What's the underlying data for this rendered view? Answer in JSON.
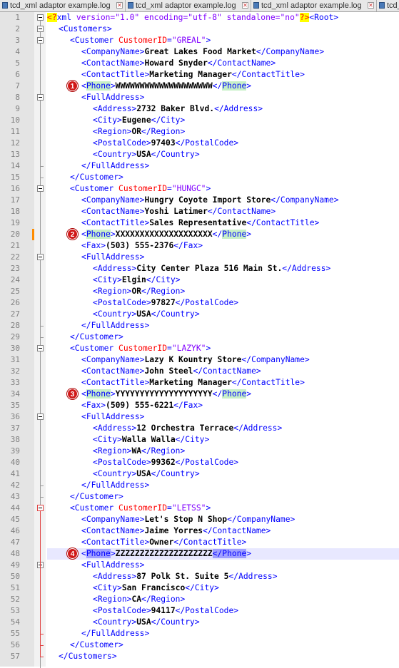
{
  "tabs": [
    {
      "label": "tcd_xml adaptor example.log"
    },
    {
      "label": "tcd_xml adaptor example.log"
    },
    {
      "label": "tcd_xml adaptor example.log"
    },
    {
      "label": "tcd_"
    }
  ],
  "tab_close_glyph": "✕",
  "badges": [
    "1",
    "2",
    "3",
    "4"
  ],
  "lines": [
    {
      "n": "1",
      "k": "decl"
    },
    {
      "n": "2",
      "k": "open",
      "indent": 1,
      "tag": "Customers"
    },
    {
      "n": "3",
      "k": "cust",
      "indent": 2,
      "id": "GREAL"
    },
    {
      "n": "4",
      "k": "leaf",
      "indent": 3,
      "tag": "CompanyName",
      "val": "Great Lakes Food Market"
    },
    {
      "n": "5",
      "k": "leaf",
      "indent": 3,
      "tag": "ContactName",
      "val": "Howard Snyder"
    },
    {
      "n": "6",
      "k": "leaf",
      "indent": 3,
      "tag": "ContactTitle",
      "val": "Marketing Manager"
    },
    {
      "n": "7",
      "k": "phone",
      "indent": 3,
      "val": "WWWWWWWWWWWWWWWWWWWW",
      "badge": 0
    },
    {
      "n": "8",
      "k": "open",
      "indent": 3,
      "tag": "FullAddress"
    },
    {
      "n": "9",
      "k": "leaf",
      "indent": 4,
      "tag": "Address",
      "val": "2732 Baker Blvd."
    },
    {
      "n": "10",
      "k": "leaf",
      "indent": 4,
      "tag": "City",
      "val": "Eugene"
    },
    {
      "n": "11",
      "k": "leaf",
      "indent": 4,
      "tag": "Region",
      "val": "OR"
    },
    {
      "n": "12",
      "k": "leaf",
      "indent": 4,
      "tag": "PostalCode",
      "val": "97403"
    },
    {
      "n": "13",
      "k": "leaf",
      "indent": 4,
      "tag": "Country",
      "val": "USA"
    },
    {
      "n": "14",
      "k": "close",
      "indent": 3,
      "tag": "FullAddress"
    },
    {
      "n": "15",
      "k": "close",
      "indent": 2,
      "tag": "Customer"
    },
    {
      "n": "16",
      "k": "cust",
      "indent": 2,
      "id": "HUNGC"
    },
    {
      "n": "17",
      "k": "leaf",
      "indent": 3,
      "tag": "CompanyName",
      "val": "Hungry Coyote Import Store"
    },
    {
      "n": "18",
      "k": "leaf",
      "indent": 3,
      "tag": "ContactName",
      "val": "Yoshi Latimer"
    },
    {
      "n": "19",
      "k": "leaf",
      "indent": 3,
      "tag": "ContactTitle",
      "val": "Sales Representative"
    },
    {
      "n": "20",
      "k": "phone",
      "indent": 3,
      "val": "XXXXXXXXXXXXXXXXXXXX",
      "badge": 1
    },
    {
      "n": "21",
      "k": "leaf",
      "indent": 3,
      "tag": "Fax",
      "val": "(503) 555-2376"
    },
    {
      "n": "22",
      "k": "open",
      "indent": 3,
      "tag": "FullAddress"
    },
    {
      "n": "23",
      "k": "leaf",
      "indent": 4,
      "tag": "Address",
      "val": "City Center Plaza 516 Main St."
    },
    {
      "n": "24",
      "k": "leaf",
      "indent": 4,
      "tag": "City",
      "val": "Elgin"
    },
    {
      "n": "25",
      "k": "leaf",
      "indent": 4,
      "tag": "Region",
      "val": "OR"
    },
    {
      "n": "26",
      "k": "leaf",
      "indent": 4,
      "tag": "PostalCode",
      "val": "97827"
    },
    {
      "n": "27",
      "k": "leaf",
      "indent": 4,
      "tag": "Country",
      "val": "USA"
    },
    {
      "n": "28",
      "k": "close",
      "indent": 3,
      "tag": "FullAddress"
    },
    {
      "n": "29",
      "k": "close",
      "indent": 2,
      "tag": "Customer"
    },
    {
      "n": "30",
      "k": "cust",
      "indent": 2,
      "id": "LAZYK"
    },
    {
      "n": "31",
      "k": "leaf",
      "indent": 3,
      "tag": "CompanyName",
      "val": "Lazy K Kountry Store"
    },
    {
      "n": "32",
      "k": "leaf",
      "indent": 3,
      "tag": "ContactName",
      "val": "John Steel"
    },
    {
      "n": "33",
      "k": "leaf",
      "indent": 3,
      "tag": "ContactTitle",
      "val": "Marketing Manager"
    },
    {
      "n": "34",
      "k": "phone",
      "indent": 3,
      "val": "YYYYYYYYYYYYYYYYYYYY",
      "badge": 2
    },
    {
      "n": "35",
      "k": "leaf",
      "indent": 3,
      "tag": "Fax",
      "val": "(509) 555-6221"
    },
    {
      "n": "36",
      "k": "open",
      "indent": 3,
      "tag": "FullAddress"
    },
    {
      "n": "37",
      "k": "leaf",
      "indent": 4,
      "tag": "Address",
      "val": "12 Orchestra Terrace"
    },
    {
      "n": "38",
      "k": "leaf",
      "indent": 4,
      "tag": "City",
      "val": "Walla Walla"
    },
    {
      "n": "39",
      "k": "leaf",
      "indent": 4,
      "tag": "Region",
      "val": "WA"
    },
    {
      "n": "40",
      "k": "leaf",
      "indent": 4,
      "tag": "PostalCode",
      "val": "99362"
    },
    {
      "n": "41",
      "k": "leaf",
      "indent": 4,
      "tag": "Country",
      "val": "USA"
    },
    {
      "n": "42",
      "k": "close",
      "indent": 3,
      "tag": "FullAddress"
    },
    {
      "n": "43",
      "k": "close",
      "indent": 2,
      "tag": "Customer"
    },
    {
      "n": "44",
      "k": "cust",
      "indent": 2,
      "id": "LETSS"
    },
    {
      "n": "45",
      "k": "leaf",
      "indent": 3,
      "tag": "CompanyName",
      "val": "Let's Stop N Shop"
    },
    {
      "n": "46",
      "k": "leaf",
      "indent": 3,
      "tag": "ContactName",
      "val": "Jaime Yorres"
    },
    {
      "n": "47",
      "k": "leaf",
      "indent": 3,
      "tag": "ContactTitle",
      "val": "Owner"
    },
    {
      "n": "48",
      "k": "phone",
      "indent": 3,
      "val": "ZZZZZZZZZZZZZZZZZZZZ",
      "badge": 3,
      "current": true
    },
    {
      "n": "49",
      "k": "open",
      "indent": 3,
      "tag": "FullAddress"
    },
    {
      "n": "50",
      "k": "leaf",
      "indent": 4,
      "tag": "Address",
      "val": "87 Polk St. Suite 5"
    },
    {
      "n": "51",
      "k": "leaf",
      "indent": 4,
      "tag": "City",
      "val": "San Francisco"
    },
    {
      "n": "52",
      "k": "leaf",
      "indent": 4,
      "tag": "Region",
      "val": "CA"
    },
    {
      "n": "53",
      "k": "leaf",
      "indent": 4,
      "tag": "PostalCode",
      "val": "94117"
    },
    {
      "n": "54",
      "k": "leaf",
      "indent": 4,
      "tag": "Country",
      "val": "USA"
    },
    {
      "n": "55",
      "k": "close",
      "indent": 3,
      "tag": "FullAddress"
    },
    {
      "n": "56",
      "k": "close",
      "indent": 2,
      "tag": "Customer"
    },
    {
      "n": "57",
      "k": "close",
      "indent": 1,
      "tag": "Customers"
    }
  ],
  "decl": {
    "pi_open": "<?",
    "name": "xml",
    "attrs": " version=\"1.0\" encoding=\"utf-8\" standalone=\"no\"",
    "pi_close": "?>",
    "root": "<Root>"
  },
  "colors": {
    "tag": "#0000ff",
    "attr": "#ff0000",
    "attr_value": "#8000ff",
    "phone_highlight": "#c8f0c8",
    "current_highlight": "#a0a0ff",
    "badge": "#d01818",
    "change_marker": "#ff8c00"
  }
}
